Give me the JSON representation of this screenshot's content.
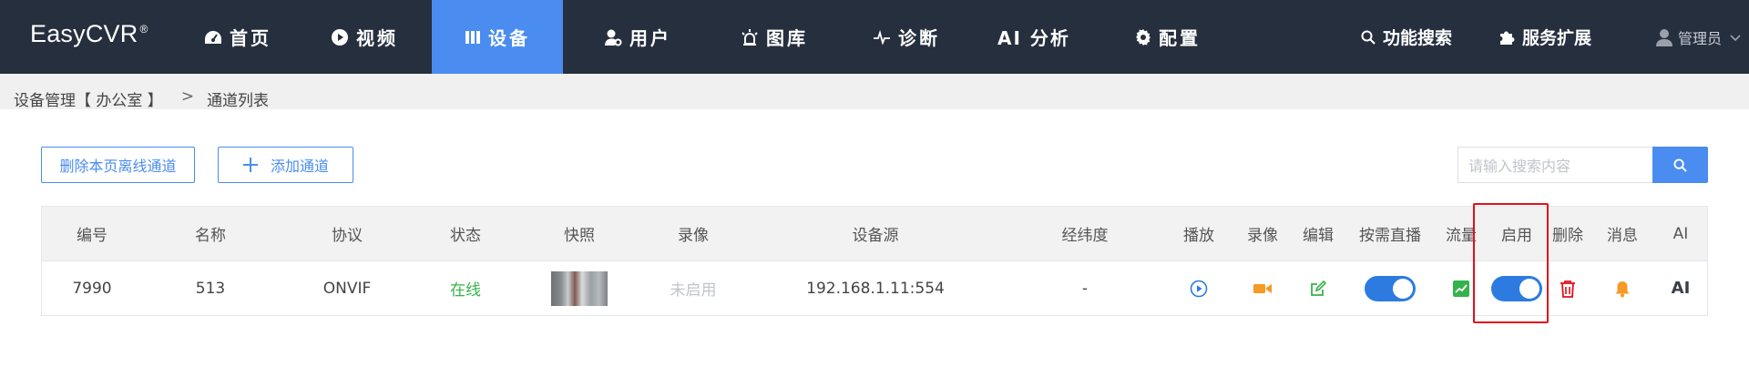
{
  "app": {
    "logo": "EasyCVR",
    "logo_mark": "®"
  },
  "nav": {
    "items": [
      {
        "label": "首页",
        "icon": "dashboard-icon"
      },
      {
        "label": "视频",
        "icon": "play-circle-icon"
      },
      {
        "label": "设备",
        "icon": "device-icon",
        "active": true
      },
      {
        "label": "用户",
        "icon": "user-gear-icon"
      },
      {
        "label": "图库",
        "icon": "alarm-light-icon"
      },
      {
        "label": "诊断",
        "icon": "pulse-icon"
      },
      {
        "label": "AI 分析",
        "icon": ""
      },
      {
        "label": "配置",
        "icon": "gear-icon"
      }
    ],
    "feature_search": "功能搜索",
    "service_ext": "服务扩展",
    "user": "管理员"
  },
  "breadcrumb": {
    "parent": "设备管理【 办公室 】",
    "separator": ">",
    "current": "通道列表"
  },
  "toolbar": {
    "delete_offline": "删除本页离线通道",
    "add_channel": "添加通道",
    "search_placeholder": "请输入搜索内容"
  },
  "table": {
    "headers": {
      "id": "编号",
      "name": "名称",
      "protocol": "协议",
      "status": "状态",
      "snapshot": "快照",
      "record": "录像",
      "source": "设备源",
      "geo": "经纬度",
      "play": "播放",
      "record_action": "录像",
      "edit": "编辑",
      "ondemand": "按需直播",
      "flow": "流量",
      "enable": "启用",
      "delete": "删除",
      "message": "消息",
      "ai": "AI"
    },
    "rows": [
      {
        "id": "7990",
        "name": "513",
        "protocol": "ONVIF",
        "status": "在线",
        "record": "未启用",
        "source": "192.168.1.11:554",
        "geo": "-",
        "ondemand_on": true,
        "enable_on": true,
        "ai": "AI"
      }
    ]
  },
  "colors": {
    "nav_bg": "#262f3e",
    "accent": "#4a8cf0",
    "online": "#36b24a",
    "toggle": "#2d7be0",
    "play": "#2d7be0",
    "record": "#f59a23",
    "edit": "#36b24a",
    "delete": "#e0101a",
    "message": "#f59a23",
    "highlight": "#e0101a"
  }
}
